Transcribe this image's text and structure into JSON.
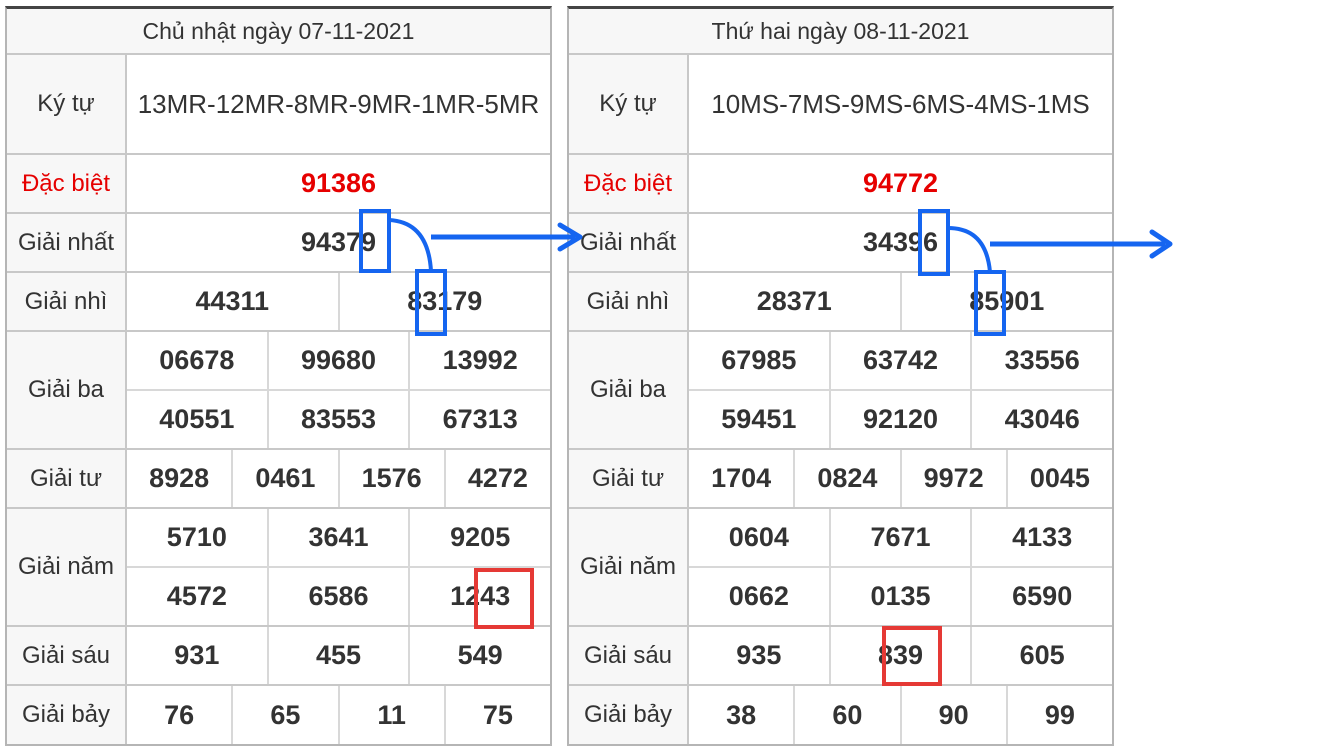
{
  "tables": [
    {
      "date_title": "Chủ nhật ngày 07-11-2021",
      "ky_tu_label": "Ký tự",
      "ky_tu_value": "13MR-12MR-8MR-9MR-1MR-5MR",
      "dac_biet_label": "Đặc biệt",
      "dac_biet": "91386",
      "nhat_label": "Giải nhất",
      "nhat": "94379",
      "nhi_label": "Giải nhì",
      "nhi": [
        "44311",
        "83179"
      ],
      "ba_label": "Giải ba",
      "ba_row1": [
        "06678",
        "99680",
        "13992"
      ],
      "ba_row2": [
        "40551",
        "83553",
        "67313"
      ],
      "tu_label": "Giải tư",
      "tu": [
        "8928",
        "0461",
        "1576",
        "4272"
      ],
      "nam_label": "Giải năm",
      "nam_row1": [
        "5710",
        "3641",
        "9205"
      ],
      "nam_row2": [
        "4572",
        "6586",
        "1243"
      ],
      "sau_label": "Giải sáu",
      "sau": [
        "931",
        "455",
        "549"
      ],
      "bay_label": "Giải bảy",
      "bay": [
        "76",
        "65",
        "11",
        "75"
      ]
    },
    {
      "date_title": "Thứ hai ngày 08-11-2021",
      "ky_tu_label": "Ký tự",
      "ky_tu_value": "10MS-7MS-9MS-6MS-4MS-1MS",
      "dac_biet_label": "Đặc biệt",
      "dac_biet": "94772",
      "nhat_label": "Giải nhất",
      "nhat": "34396",
      "nhi_label": "Giải nhì",
      "nhi": [
        "28371",
        "85901"
      ],
      "ba_label": "Giải ba",
      "ba_row1": [
        "67985",
        "63742",
        "33556"
      ],
      "ba_row2": [
        "59451",
        "92120",
        "43046"
      ],
      "tu_label": "Giải tư",
      "tu": [
        "1704",
        "0824",
        "9972",
        "0045"
      ],
      "nam_label": "Giải năm",
      "nam_row1": [
        "0604",
        "7671",
        "4133"
      ],
      "nam_row2": [
        "0662",
        "0135",
        "6590"
      ],
      "sau_label": "Giải sáu",
      "sau": [
        "935",
        "839",
        "605"
      ],
      "bay_label": "Giải bảy",
      "bay": [
        "38",
        "60",
        "90",
        "99"
      ]
    }
  ],
  "colors": {
    "special": "#e60000",
    "highlight_blue": "#1565f0",
    "highlight_red": "#e53935"
  }
}
